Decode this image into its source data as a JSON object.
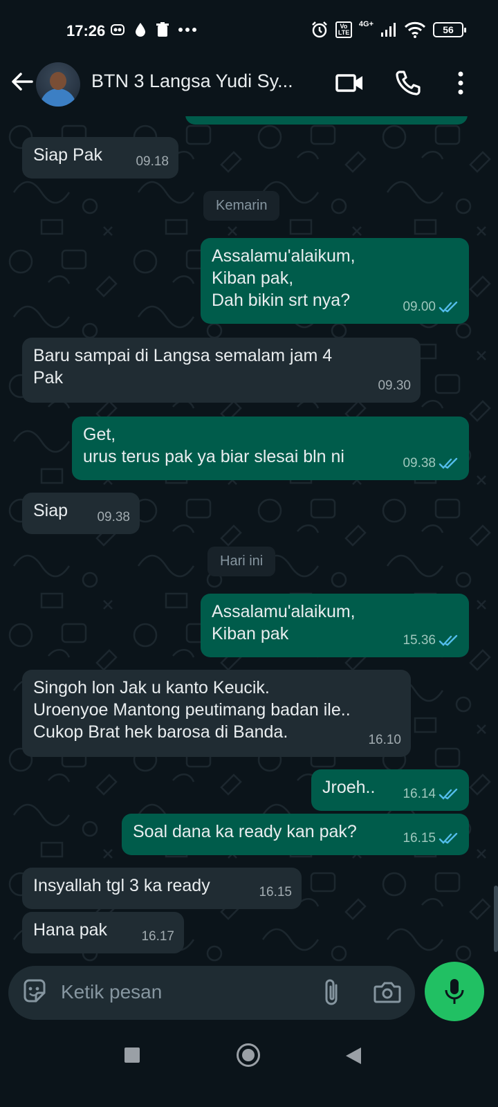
{
  "status_bar": {
    "time": "17:26",
    "network": "4G+",
    "volte": "Vo LTE",
    "battery": "56"
  },
  "header": {
    "title": "BTN 3 Langsa Yudi Sy..."
  },
  "messages": [
    {
      "dir": "in",
      "text": "Siap Pak",
      "time": "09.18"
    },
    {
      "type": "date",
      "text": "Kemarin"
    },
    {
      "dir": "out",
      "text": "Assalamu'alaikum,\nKiban pak,\nDah bikin srt nya?",
      "time": "09.00",
      "read": true
    },
    {
      "dir": "in",
      "text": "Baru sampai di Langsa semalam jam 4\nPak",
      "time": "09.30"
    },
    {
      "dir": "out",
      "text": "Get,\nurus terus pak ya biar slesai bln ni",
      "time": "09.38",
      "read": true
    },
    {
      "dir": "in",
      "text": "Siap",
      "time": "09.38"
    },
    {
      "type": "date",
      "text": "Hari ini"
    },
    {
      "dir": "out",
      "text": "Assalamu'alaikum,\nKiban pak",
      "time": "15.36",
      "read": true
    },
    {
      "dir": "in",
      "text": "Singoh lon Jak u kanto Keucik.\nUroenyoe Mantong peutimang badan ile..\nCukop Brat hek barosa di Banda.",
      "time": "16.10"
    },
    {
      "dir": "out",
      "text": "Jroeh..",
      "time": "16.14",
      "read": true
    },
    {
      "dir": "out",
      "text": "Soal dana ka ready kan pak?",
      "time": "16.15",
      "read": true
    },
    {
      "dir": "in",
      "text": "Insyallah tgl 3 ka ready",
      "time": "16.15"
    },
    {
      "dir": "in",
      "text": "Hana pak",
      "time": "16.17"
    }
  ],
  "input": {
    "placeholder": "Ketik pesan"
  },
  "icons": {
    "back": "back-arrow-icon",
    "video": "video-camera-icon",
    "call": "phone-icon",
    "menu": "more-vert-icon",
    "emoji": "sticker-icon",
    "attach": "paperclip-icon",
    "camera": "camera-icon",
    "mic": "microphone-icon"
  },
  "colors": {
    "background": "#0b141a",
    "incoming_bubble": "#202c33",
    "outgoing_bubble": "#005c4b",
    "read_tick": "#53bdeb",
    "mic_button": "#21c063"
  }
}
